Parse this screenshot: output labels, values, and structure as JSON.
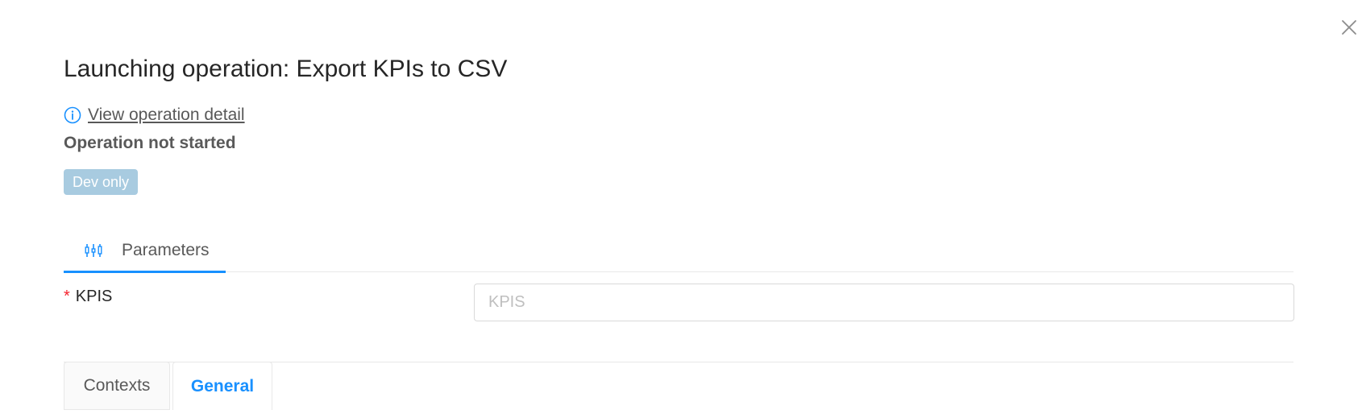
{
  "dialog": {
    "title": "Launching operation: Export KPIs to CSV",
    "close_icon": "close-icon"
  },
  "detail_link": {
    "icon": "info-circle-icon",
    "label": "View operation detail"
  },
  "status": {
    "text": "Operation not started"
  },
  "badge": {
    "label": "Dev only"
  },
  "tabs": {
    "items": [
      {
        "label": "Parameters",
        "icon": "sliders-icon",
        "active": true
      }
    ]
  },
  "form": {
    "fields": [
      {
        "label": "KPIS",
        "required_mark": "*",
        "value": "",
        "placeholder": "KPIS"
      }
    ]
  },
  "bottom_tabs": {
    "items": [
      {
        "label": "Contexts",
        "active": false
      },
      {
        "label": "General",
        "active": true
      }
    ]
  },
  "colors": {
    "accent": "#1890ff",
    "badge_bg": "#a8cbe0",
    "required": "#f5222d",
    "border": "#e8e8e8"
  }
}
